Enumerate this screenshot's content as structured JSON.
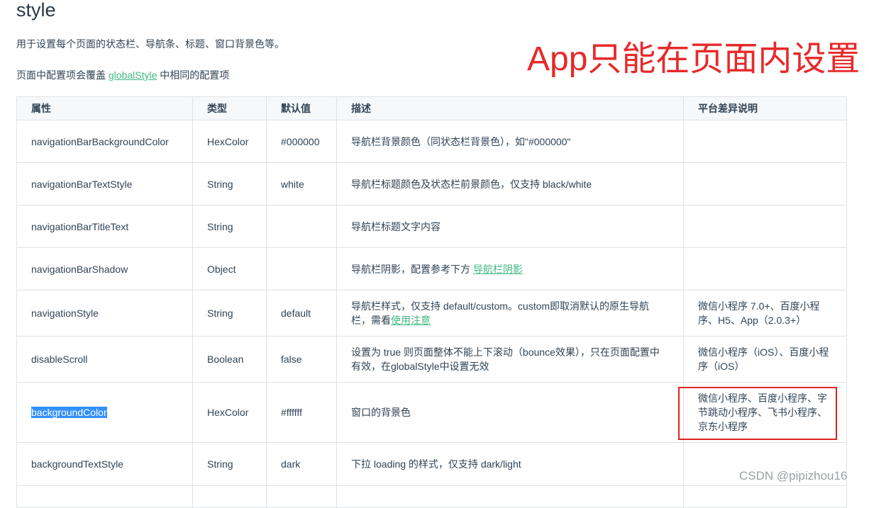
{
  "page": {
    "heading": "style",
    "intro": "用于设置每个页面的状态栏、导航条、标题、窗口背景色等。",
    "override_prefix": "页面中配置项会覆盖 ",
    "override_link": "globalStyle",
    "override_suffix": " 中相同的配置项",
    "annotation": "App只能在页面内设置",
    "watermark": "CSDN @pipizhou16"
  },
  "table": {
    "columns": [
      "属性",
      "类型",
      "默认值",
      "描述",
      "平台差异说明"
    ],
    "rows": [
      {
        "name": "navigationBarBackgroundColor",
        "type": "HexColor",
        "default": "#000000",
        "desc": "导航栏背景颜色（同状态栏背景色），如\"#000000\"",
        "platform": ""
      },
      {
        "name": "navigationBarTextStyle",
        "type": "String",
        "default": "white",
        "desc": "导航栏标题颜色及状态栏前景颜色，仅支持 black/white",
        "platform": ""
      },
      {
        "name": "navigationBarTitleText",
        "type": "String",
        "default": "",
        "desc": "导航栏标题文字内容",
        "platform": ""
      },
      {
        "name": "navigationBarShadow",
        "type": "Object",
        "default": "",
        "desc": "导航栏阴影，配置参考下方 ",
        "desc_link": "导航栏阴影",
        "platform": ""
      },
      {
        "name": "navigationStyle",
        "type": "String",
        "default": "default",
        "desc": "导航栏样式，仅支持 default/custom。custom即取消默认的原生导航栏，需看",
        "desc_link": "使用注意",
        "platform": "微信小程序 7.0+、百度小程序、H5、App（2.0.3+）"
      },
      {
        "name": "disableScroll",
        "type": "Boolean",
        "default": "false",
        "desc": "设置为 true 则页面整体不能上下滚动（bounce效果），只在页面配置中有效，在globalStyle中设置无效",
        "platform": "微信小程序（iOS）、百度小程序（iOS）"
      },
      {
        "name": "backgroundColor",
        "type": "HexColor",
        "default": "#ffffff",
        "desc": "窗口的背景色",
        "platform": "微信小程序、百度小程序、字节跳动小程序、飞书小程序、京东小程序"
      },
      {
        "name": "backgroundTextStyle",
        "type": "String",
        "default": "dark",
        "desc": "下拉 loading 的样式，仅支持 dark/light",
        "platform": ""
      }
    ]
  },
  "colors": {
    "link": "#42b983",
    "annotation": "#e8292a",
    "selection": "#3390ff",
    "highlight_box": "#e02020"
  }
}
